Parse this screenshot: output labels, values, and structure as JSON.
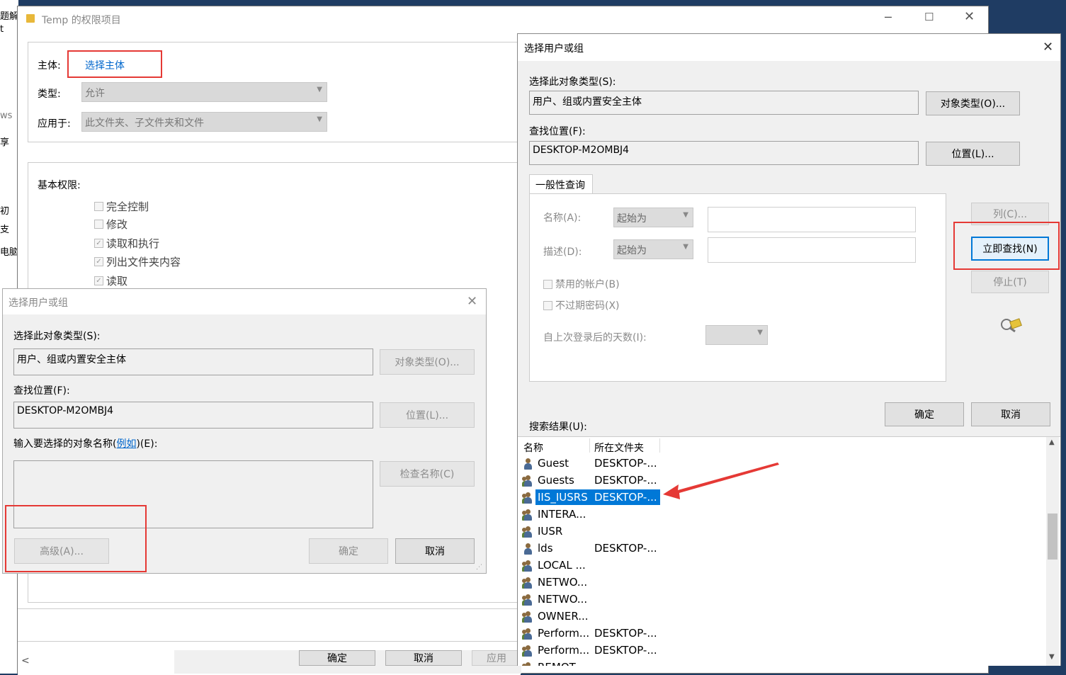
{
  "bg_window": {
    "title": "Temp 的权限项目",
    "principal_label": "主体:",
    "principal_link": "选择主体",
    "type_label": "类型:",
    "type_value": "允许",
    "applies_label": "应用于:",
    "applies_value": "此文件夹、子文件夹和文件",
    "basic_perms_label": "基本权限:",
    "perms": [
      "完全控制",
      "修改",
      "读取和执行",
      "列出文件夹内容",
      "读取"
    ],
    "bottom_buttons": [
      "确定",
      "取消",
      "应用"
    ]
  },
  "left_edge": {
    "texts": [
      "题解",
      "t",
      "ws",
      "享",
      "初",
      "支",
      "电脑"
    ]
  },
  "small_dialog": {
    "title": "选择用户或组",
    "object_type_label": "选择此对象类型(S):",
    "object_type_value": "用户、组或内置安全主体",
    "object_type_button": "对象类型(O)...",
    "location_label": "查找位置(F):",
    "location_value": "DESKTOP-M2OMBJ4",
    "location_button": "位置(L)...",
    "enter_label_prefix": "输入要选择的对象名称(",
    "enter_label_link": "例如",
    "enter_label_suffix": ")(E):",
    "check_names_button": "检查名称(C)",
    "advanced_button": "高级(A)...",
    "ok_button": "确定",
    "cancel_button": "取消"
  },
  "big_dialog": {
    "title": "选择用户或组",
    "object_type_label": "选择此对象类型(S):",
    "object_type_value": "用户、组或内置安全主体",
    "object_type_button": "对象类型(O)...",
    "location_label": "查找位置(F):",
    "location_value": "DESKTOP-M2OMBJ4",
    "location_button": "位置(L)...",
    "tab_label": "一般性查询",
    "name_label": "名称(A):",
    "name_combo": "起始为",
    "desc_label": "描述(D):",
    "desc_combo": "起始为",
    "disabled_accounts": "禁用的帐户(B)",
    "non_expiring": "不过期密码(X)",
    "days_label": "自上次登录后的天数(I):",
    "columns_button": "列(C)...",
    "find_now_button": "立即查找(N)",
    "stop_button": "停止(T)",
    "ok_button": "确定",
    "cancel_button": "取消",
    "results_label": "搜索结果(U):",
    "col_name": "名称",
    "col_folder": "所在文件夹",
    "results": [
      {
        "name": "Guest",
        "folder": "DESKTOP-...",
        "icon": "user-icon"
      },
      {
        "name": "Guests",
        "folder": "DESKTOP-...",
        "icon": "group-icon"
      },
      {
        "name": "IIS_IUSRS",
        "folder": "DESKTOP-...",
        "icon": "group-icon",
        "selected": true
      },
      {
        "name": "INTERA...",
        "folder": "",
        "icon": "group-icon"
      },
      {
        "name": "IUSR",
        "folder": "",
        "icon": "group-icon"
      },
      {
        "name": "lds",
        "folder": "DESKTOP-...",
        "icon": "user-icon"
      },
      {
        "name": "LOCAL ...",
        "folder": "",
        "icon": "group-icon"
      },
      {
        "name": "NETWO...",
        "folder": "",
        "icon": "group-icon"
      },
      {
        "name": "NETWO...",
        "folder": "",
        "icon": "group-icon"
      },
      {
        "name": "OWNER...",
        "folder": "",
        "icon": "group-icon"
      },
      {
        "name": "Perform...",
        "folder": "DESKTOP-...",
        "icon": "group-icon"
      },
      {
        "name": "Perform...",
        "folder": "DESKTOP-...",
        "icon": "group-icon"
      },
      {
        "name": "REMOT...",
        "folder": "",
        "icon": "group-icon"
      }
    ]
  },
  "colors": {
    "accent": "#0078d7",
    "annotation_red": "#e53935",
    "link": "#0066cc"
  }
}
